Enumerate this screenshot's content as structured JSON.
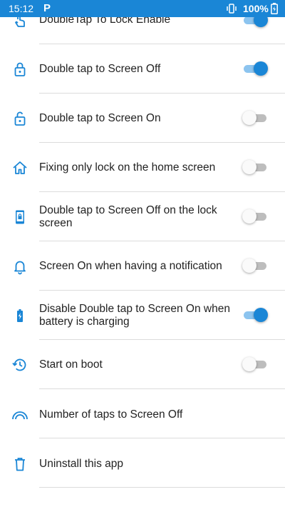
{
  "status_bar": {
    "time": "15:12",
    "app_badge": "P",
    "battery": "100%"
  },
  "colors": {
    "accent": "#1a86d6",
    "track_on": "#8cc4ef",
    "track_off": "#bdbdbd"
  },
  "settings": [
    {
      "label": "DoubleTap To Lock Enable",
      "icon": "touch-icon",
      "toggle": true
    },
    {
      "label": "Double tap to Screen Off",
      "icon": "lock-icon",
      "toggle": true
    },
    {
      "label": "Double tap to Screen On",
      "icon": "lock-open-icon",
      "toggle": false
    },
    {
      "label": "Fixing only lock on the home screen",
      "icon": "home-icon",
      "toggle": false
    },
    {
      "label": "Double tap to Screen Off on the lock screen",
      "icon": "phone-lock-icon",
      "toggle": false
    },
    {
      "label": "Screen On when having a notification",
      "icon": "bell-icon",
      "toggle": false
    },
    {
      "label": "Disable Double tap to Screen On when battery is charging",
      "icon": "battery-charging-icon",
      "toggle": true
    },
    {
      "label": "Start on boot",
      "icon": "history-icon",
      "toggle": false
    },
    {
      "label": "Number of taps to Screen Off",
      "icon": "signal-arc-icon",
      "toggle": null
    },
    {
      "label": "Uninstall this app",
      "icon": "trash-icon",
      "toggle": null
    }
  ]
}
